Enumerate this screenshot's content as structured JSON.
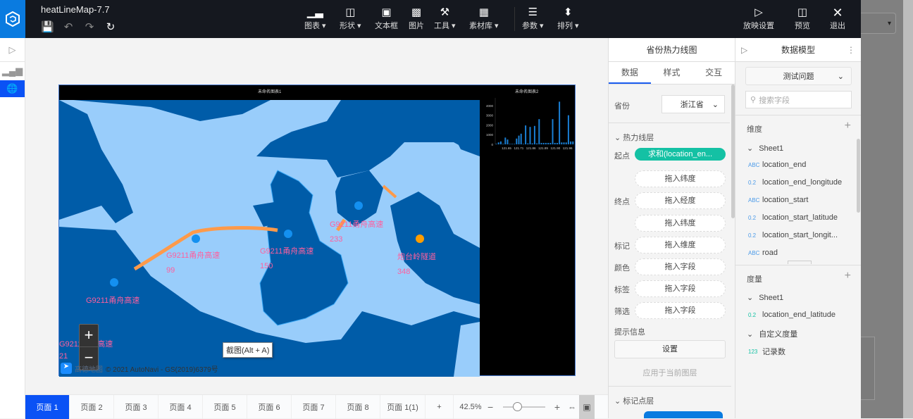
{
  "app": {
    "title": "heatLineMap-7.7"
  },
  "toolbar": {
    "tools": [
      {
        "label": "图表",
        "icon": "bar-chart-icon",
        "caret": true
      },
      {
        "label": "形状",
        "icon": "shape-icon",
        "caret": true
      },
      {
        "label": "文本框",
        "icon": "textbox-icon",
        "caret": false
      },
      {
        "label": "图片",
        "icon": "image-icon",
        "caret": false
      },
      {
        "label": "工具",
        "icon": "hammer-icon",
        "caret": true
      },
      {
        "label": "素材库",
        "icon": "library-icon",
        "caret": true
      },
      {
        "label": "参数",
        "icon": "sliders-icon",
        "caret": true
      },
      {
        "label": "排列",
        "icon": "arrange-icon",
        "caret": true
      }
    ],
    "right": [
      {
        "label": "放映设置",
        "icon": "play-icon"
      },
      {
        "label": "预览",
        "icon": "preview-icon"
      },
      {
        "label": "退出",
        "icon": "close-icon"
      }
    ]
  },
  "chart1": {
    "title": "未命名图表1"
  },
  "chart2": {
    "title": "未命名图表2"
  },
  "map": {
    "labels": [
      {
        "name": "G9211甬舟高速",
        "value": "99"
      },
      {
        "name": "G9211甬舟高速",
        "value": "150"
      },
      {
        "name": "G9211甬舟高速",
        "value": "233"
      },
      {
        "name": "炮台岭隧道",
        "value": "348"
      },
      {
        "name": "G9211甬舟高速",
        "value": ""
      },
      {
        "name": "G9211甬舟高速",
        "value": "21"
      }
    ],
    "attribution": "© 2021 AutoNavi - GS(2019)6379号",
    "brand": "高德地图",
    "tooltip": "截图(Alt + A)"
  },
  "chart_data": {
    "type": "bar",
    "title": "未命名图表2",
    "xlabel": "",
    "ylabel": "",
    "ylim": [
      0,
      4500
    ],
    "yticks": [
      "0",
      "1000",
      "2000",
      "3000",
      "4000"
    ],
    "xticks": [
      "121.65",
      "121.71",
      "121.86",
      "121.89",
      "121.90",
      "121.96"
    ],
    "values": [
      50,
      200,
      300,
      50,
      700,
      500,
      50,
      50,
      50,
      600,
      900,
      1100,
      50,
      1950,
      100,
      1800,
      100,
      1900,
      100,
      2600,
      150,
      150,
      150,
      150,
      150,
      2600,
      150,
      150,
      4400,
      200,
      200,
      200,
      3000,
      300,
      300
    ]
  },
  "pages": {
    "tabs": [
      "页面 1",
      "页面 2",
      "页面 3",
      "页面 4",
      "页面 5",
      "页面 6",
      "页面 7",
      "页面 8",
      "页面 1(1)"
    ],
    "add": "+",
    "zoom": "42.5%",
    "zoom_fraction": 0.3,
    "minus": "−",
    "plus": "+"
  },
  "panel1": {
    "title": "省份热力线图",
    "tabs": [
      "数据",
      "样式",
      "交互"
    ],
    "province_label": "省份",
    "province_value": "浙江省",
    "layer1": "热力线层",
    "start_label": "起点",
    "start_value": "求和(location_en...",
    "start_lat": "拖入纬度",
    "end_label": "终点",
    "end_lng": "拖入经度",
    "end_lat": "拖入纬度",
    "mark_label": "标记",
    "mark_value": "拖入维度",
    "color_label": "颜色",
    "color_value": "拖入字段",
    "tag_label": "标签",
    "tag_value": "拖入字段",
    "filter_label": "筛选",
    "filter_value": "拖入字段",
    "tooltip_label": "提示信息",
    "settings": "设置",
    "apply": "应用于当前图层",
    "layer2": "标记点层"
  },
  "panel2": {
    "title": "数据模型",
    "dataset": "测试问题",
    "search_placeholder": "搜索字段",
    "dim_title": "维度",
    "dim_sheet": "Sheet1",
    "dims": [
      {
        "type": "ABC",
        "name": "location_end"
      },
      {
        "type": "0.2",
        "name": "location_end_longitude"
      },
      {
        "type": "ABC",
        "name": "location_start"
      },
      {
        "type": "0.2",
        "name": "location_start_latitude"
      },
      {
        "type": "0.2",
        "name": "location_start_longit..."
      },
      {
        "type": "ABC",
        "name": "road"
      }
    ],
    "measure_title": "度量",
    "measure_sheet": "Sheet1",
    "measures": [
      {
        "type": "0.2",
        "name": "location_end_latitude"
      }
    ],
    "custom_title": "自定义度量",
    "custom": [
      {
        "type": "123",
        "name": "记录数"
      }
    ]
  },
  "colors": {
    "accent": "#0a52f5",
    "teal": "#14c1a4",
    "topbar": "#15181f",
    "road": "#ff9a4a",
    "label": "#ff5f9e"
  }
}
